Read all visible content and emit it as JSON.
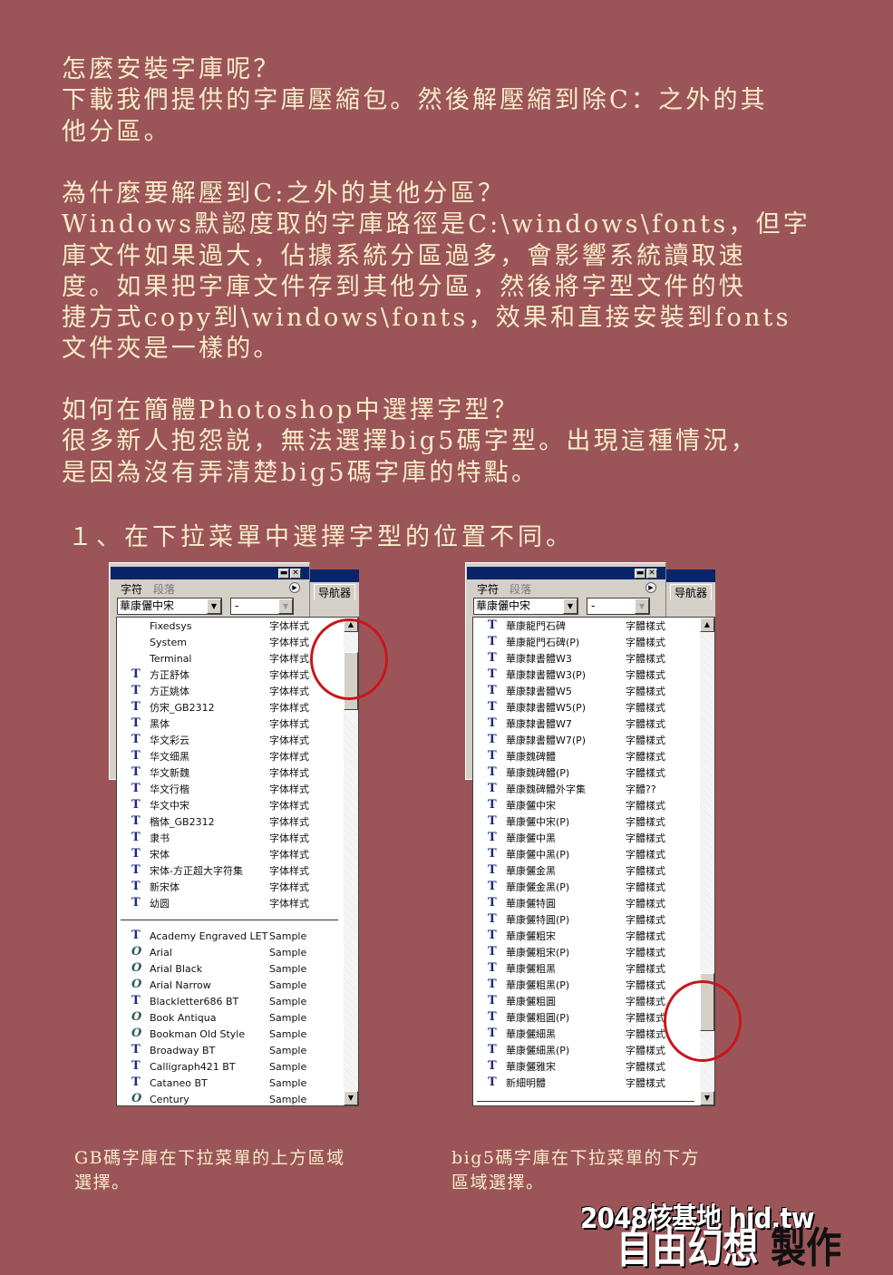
{
  "colors": {
    "background": "#9b5558",
    "text": "#f7ecc9",
    "circle": "#c8161c",
    "titlebar": "#0a246a"
  },
  "sections": [
    {
      "lines": [
        "怎麼安裝字庫呢？",
        "下載我們提供的字庫壓縮包。然後解壓縮到除C：之外的其",
        "他分區。"
      ]
    },
    {
      "lines": [
        "為什麼要解壓到C:之外的其他分區？",
        "Windows默認度取的字庫路徑是C:\\windows\\fonts，但字",
        "庫文件如果過大，佔據系統分區過多，會影響系統讀取速",
        "度。如果把字庫文件存到其他分區，然後將字型文件的快",
        "捷方式copy到\\windows\\fonts，效果和直接安裝到fonts",
        "文件夾是一樣的。"
      ]
    },
    {
      "lines": [
        "如何在簡體Photoshop中選擇字型？",
        "很多新人抱怨説，無法選擇big5碼字型。出現這種情況，",
        "是因為沒有弄清楚big5碼字庫的特點。"
      ]
    }
  ],
  "heading": "１、在下拉菜單中選擇字型的位置不同。",
  "panels": [
    {
      "tabs": [
        "字符",
        "段落"
      ],
      "navigator": "导航器",
      "font_value": "華康儷中宋",
      "style_value": "-",
      "groups": [
        [
          {
            "icon": "none",
            "name": "Fixedsys",
            "sample": "字体样式"
          },
          {
            "icon": "none",
            "name": "System",
            "sample": "字体样式"
          },
          {
            "icon": "none",
            "name": "Terminal",
            "sample": "字体样式"
          },
          {
            "icon": "truetype",
            "name": "方正舒体",
            "sample": "字体样式"
          },
          {
            "icon": "truetype",
            "name": "方正姚体",
            "sample": "字体样式"
          },
          {
            "icon": "truetype",
            "name": "仿宋_GB2312",
            "sample": "字体样式"
          },
          {
            "icon": "truetype",
            "name": "黑体",
            "sample": "字体样式"
          },
          {
            "icon": "truetype",
            "name": "华文彩云",
            "sample": "字体样式"
          },
          {
            "icon": "truetype",
            "name": "华文细黑",
            "sample": "字体样式"
          },
          {
            "icon": "truetype",
            "name": "华文新魏",
            "sample": "字体样式"
          },
          {
            "icon": "truetype",
            "name": "华文行楷",
            "sample": "字体样式"
          },
          {
            "icon": "truetype",
            "name": "华文中宋",
            "sample": "字体样式"
          },
          {
            "icon": "truetype",
            "name": "楷体_GB2312",
            "sample": "字体样式"
          },
          {
            "icon": "truetype",
            "name": "隶书",
            "sample": "字体样式"
          },
          {
            "icon": "truetype",
            "name": "宋体",
            "sample": "字体样式"
          },
          {
            "icon": "truetype",
            "name": "宋体-方正超大字符集",
            "sample": "字体样式"
          },
          {
            "icon": "truetype",
            "name": "新宋体",
            "sample": "字体样式"
          },
          {
            "icon": "truetype",
            "name": "幼圆",
            "sample": "字体样式"
          }
        ],
        [
          {
            "icon": "truetype",
            "name": "Academy Engraved LET",
            "sample": "Sample"
          },
          {
            "icon": "opentype",
            "name": "Arial",
            "sample": "Sample"
          },
          {
            "icon": "opentype",
            "name": "Arial Black",
            "sample": "Sample"
          },
          {
            "icon": "opentype",
            "name": "Arial Narrow",
            "sample": "Sample"
          },
          {
            "icon": "truetype",
            "name": "Blackletter686 BT",
            "sample": "Sample"
          },
          {
            "icon": "opentype",
            "name": "Book Antiqua",
            "sample": "Sample"
          },
          {
            "icon": "opentype",
            "name": "Bookman Old Style",
            "sample": "Sample"
          },
          {
            "icon": "truetype",
            "name": "Broadway BT",
            "sample": "Sample"
          },
          {
            "icon": "truetype",
            "name": "Calligraph421 BT",
            "sample": "Sample"
          },
          {
            "icon": "truetype",
            "name": "Cataneo BT",
            "sample": "Sample"
          },
          {
            "icon": "opentype",
            "name": "Century",
            "sample": "Sample"
          }
        ]
      ],
      "scroll_position": 0.05,
      "caption": [
        "GB碼字庫在下拉菜單的上方區域",
        "選擇。"
      ]
    },
    {
      "tabs": [
        "字符",
        "段落"
      ],
      "navigator": "导航器",
      "font_value": "華康儷中宋",
      "style_value": "-",
      "groups": [
        [
          {
            "icon": "truetype",
            "name": "華康龍門石碑",
            "sample": "字體樣式"
          },
          {
            "icon": "truetype",
            "name": "華康龍門石碑(P)",
            "sample": "字體樣式"
          },
          {
            "icon": "truetype",
            "name": "華康隸書體W3",
            "sample": "字體樣式"
          },
          {
            "icon": "truetype",
            "name": "華康隸書體W3(P)",
            "sample": "字體樣式"
          },
          {
            "icon": "truetype",
            "name": "華康隸書體W5",
            "sample": "字體樣式"
          },
          {
            "icon": "truetype",
            "name": "華康隸書體W5(P)",
            "sample": "字體樣式"
          },
          {
            "icon": "truetype",
            "name": "華康隸書體W7",
            "sample": "字體樣式"
          },
          {
            "icon": "truetype",
            "name": "華康隸書體W7(P)",
            "sample": "字體樣式"
          },
          {
            "icon": "truetype",
            "name": "華康魏碑體",
            "sample": "字體樣式"
          },
          {
            "icon": "truetype",
            "name": "華康魏碑體(P)",
            "sample": "字體樣式"
          },
          {
            "icon": "truetype",
            "name": "華康魏碑體外字集",
            "sample": "字體??"
          },
          {
            "icon": "truetype",
            "name": "華康儷中宋",
            "sample": "字體樣式"
          },
          {
            "icon": "truetype",
            "name": "華康儷中宋(P)",
            "sample": "字體樣式"
          },
          {
            "icon": "truetype",
            "name": "華康儷中黑",
            "sample": "字體樣式"
          },
          {
            "icon": "truetype",
            "name": "華康儷中黑(P)",
            "sample": "字體樣式"
          },
          {
            "icon": "truetype",
            "name": "華康儷金黑",
            "sample": "字體樣式"
          },
          {
            "icon": "truetype",
            "name": "華康儷金黑(P)",
            "sample": "字體樣式"
          },
          {
            "icon": "truetype",
            "name": "華康儷特圓",
            "sample": "字體樣式"
          },
          {
            "icon": "truetype",
            "name": "華康儷特圓(P)",
            "sample": "字體樣式"
          },
          {
            "icon": "truetype",
            "name": "華康儷粗宋",
            "sample": "字體樣式"
          },
          {
            "icon": "truetype",
            "name": "華康儷粗宋(P)",
            "sample": "字體樣式"
          },
          {
            "icon": "truetype",
            "name": "華康儷粗黑",
            "sample": "字體樣式"
          },
          {
            "icon": "truetype",
            "name": "華康儷粗黑(P)",
            "sample": "字體樣式"
          },
          {
            "icon": "truetype",
            "name": "華康儷粗圓",
            "sample": "字體樣式"
          },
          {
            "icon": "truetype",
            "name": "華康儷粗圓(P)",
            "sample": "字體樣式"
          },
          {
            "icon": "truetype",
            "name": "華康儷細黑",
            "sample": "字體樣式"
          },
          {
            "icon": "truetype",
            "name": "華康儷細黑(P)",
            "sample": "字體樣式"
          },
          {
            "icon": "truetype",
            "name": "華康儷雅宋",
            "sample": "字體樣式"
          },
          {
            "icon": "truetype",
            "name": "新細明體",
            "sample": "字體樣式"
          }
        ]
      ],
      "scroll_position": 0.85,
      "caption": [
        "big5碼字庫在下拉菜單的下方",
        "區域選擇。"
      ]
    }
  ],
  "watermark": {
    "line1": "2048核基地 hjd.tw",
    "line2a": "自由幻想",
    "line2b": "製作"
  }
}
